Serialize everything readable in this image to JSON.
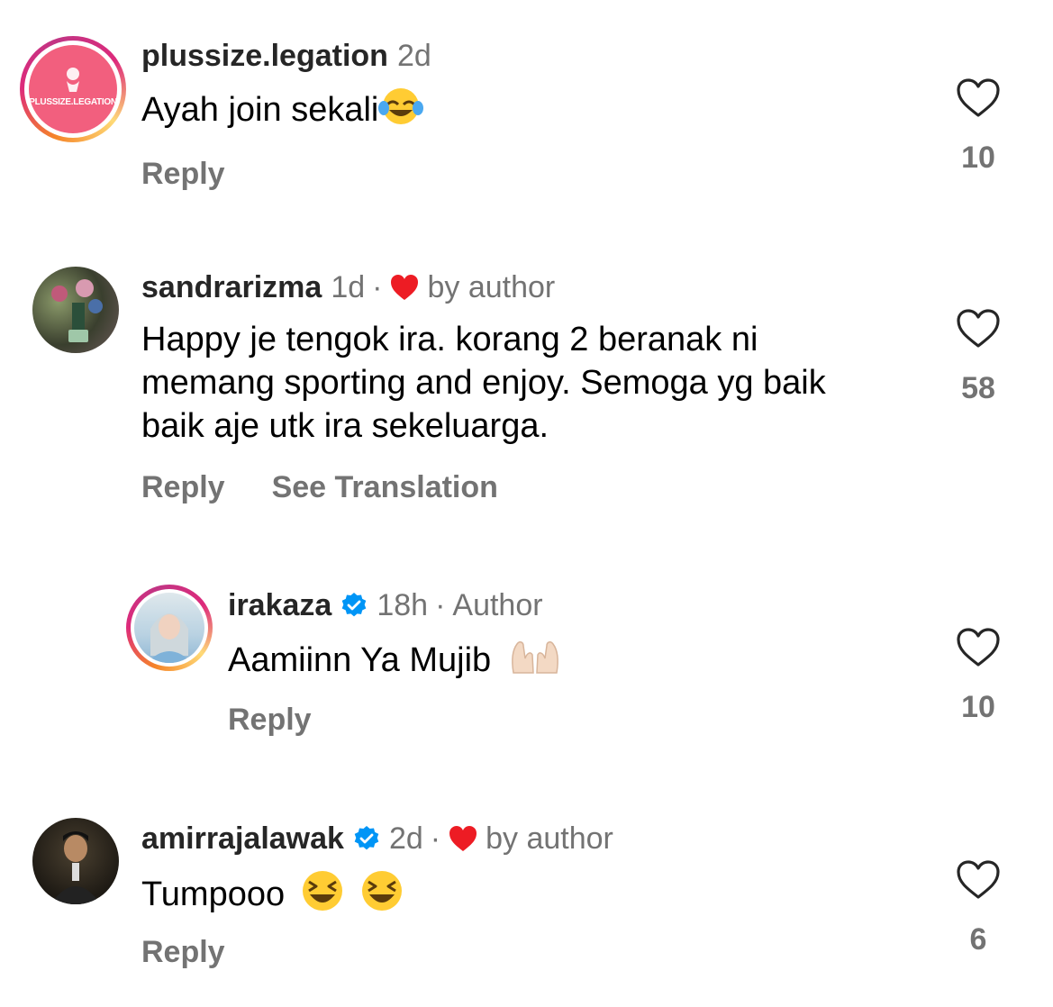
{
  "comments": [
    {
      "username": "plussize.legation",
      "time": "2d",
      "text": "Ayah join sekali",
      "emoji": "joy-emoji",
      "avatar_text": "PLUSSIZE.LEGATION",
      "reply": "Reply",
      "likes": "10"
    },
    {
      "username": "sandrarizma",
      "time": "1d",
      "sep": "·",
      "liked_by": "by author",
      "text": "Happy je tengok ira. korang 2 beranak ni memang sporting and enjoy. Semoga yg baik baik aje utk ira sekeluarga.",
      "reply": "Reply",
      "translate": "See Translation",
      "likes": "58"
    },
    {
      "username": "irakaza",
      "verified": true,
      "time": "18h",
      "sep": "·",
      "role": "Author",
      "text": "Aamiinn Ya Mujib",
      "emoji": "raised-hands-emoji",
      "reply": "Reply",
      "likes": "10"
    },
    {
      "username": "amirrajalawak",
      "verified": true,
      "time": "2d",
      "sep": "·",
      "liked_by": "by author",
      "text": "Tumpooo",
      "emoji": "laughing-emoji",
      "reply": "Reply",
      "likes": "6"
    }
  ],
  "colors": {
    "verified": "#0095f6",
    "heart_red": "#ed1c24",
    "muted": "#737373"
  }
}
